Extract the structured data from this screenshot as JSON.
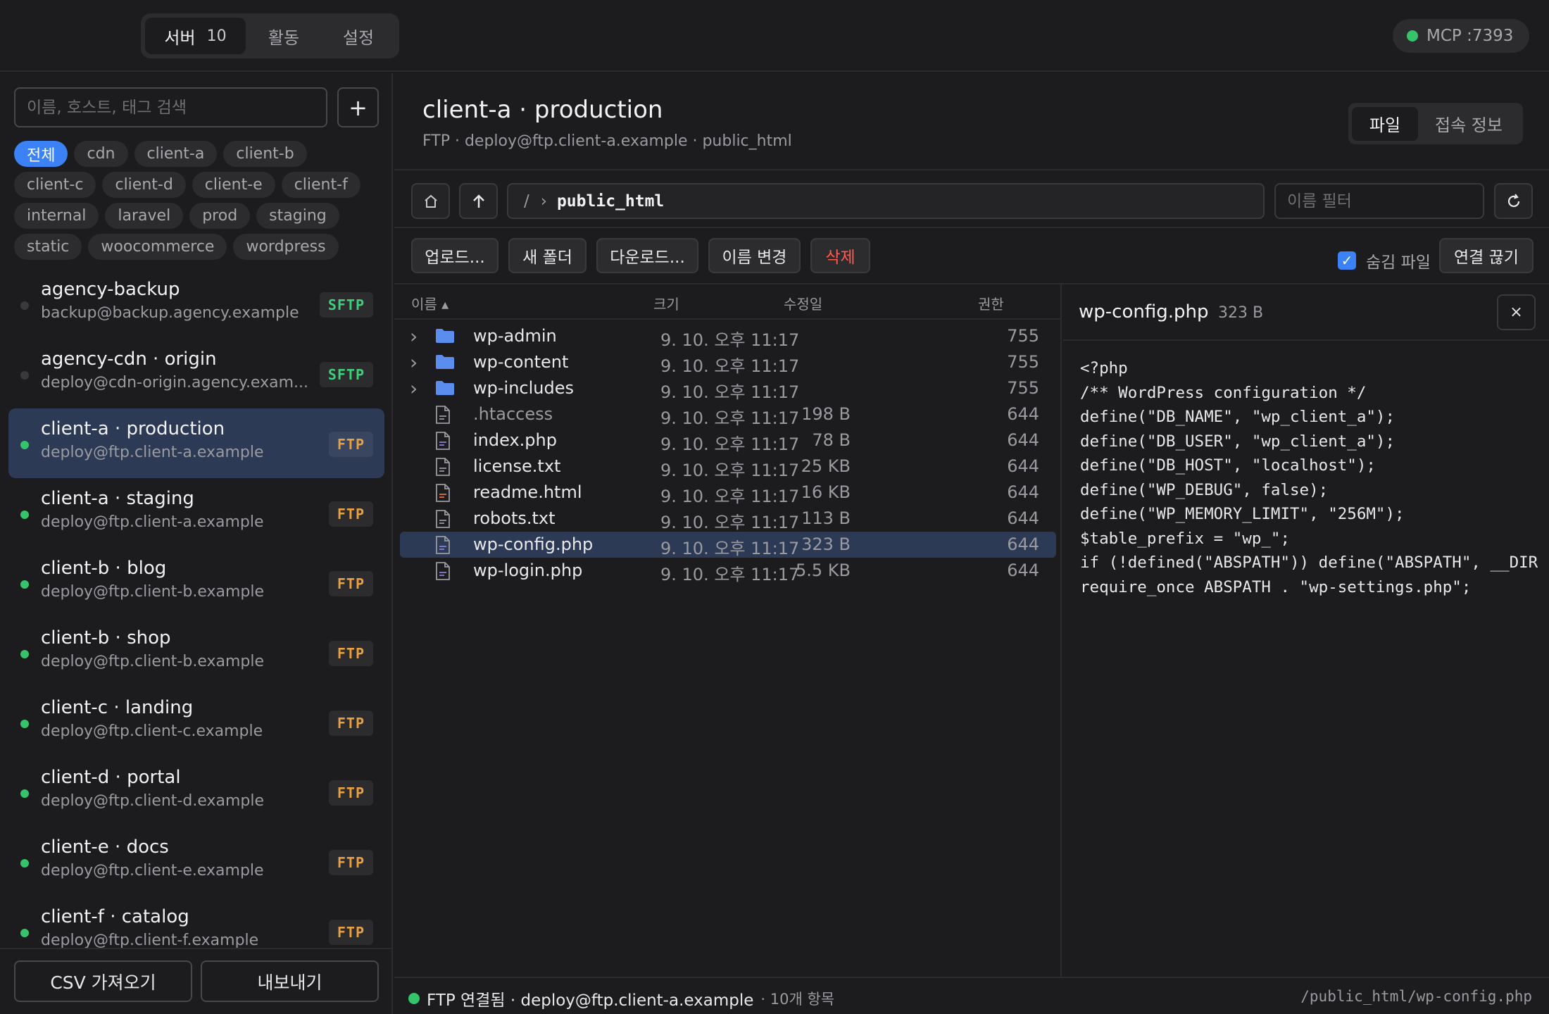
{
  "topbar": {
    "tabs": [
      {
        "label": "서버",
        "count": "10"
      },
      {
        "label": "활동"
      },
      {
        "label": "설정"
      }
    ],
    "mcp_label": "MCP :7393"
  },
  "sidebar": {
    "search_placeholder": "이름, 호스트, 태그 검색",
    "add_label": "+",
    "tags": [
      "전체",
      "cdn",
      "client-a",
      "client-b",
      "client-c",
      "client-d",
      "client-e",
      "client-f",
      "internal",
      "laravel",
      "prod",
      "staging",
      "static",
      "woocommerce",
      "wordpress"
    ],
    "servers": [
      {
        "name": "agency-backup",
        "host": "backup@backup.agency.example",
        "protocol": "SFTP",
        "status": "offline"
      },
      {
        "name": "agency-cdn · origin",
        "host": "deploy@cdn-origin.agency.exam...",
        "protocol": "SFTP",
        "status": "offline"
      },
      {
        "name": "client-a · production",
        "host": "deploy@ftp.client-a.example",
        "protocol": "FTP",
        "status": "online"
      },
      {
        "name": "client-a · staging",
        "host": "deploy@ftp.client-a.example",
        "protocol": "FTP",
        "status": "online"
      },
      {
        "name": "client-b · blog",
        "host": "deploy@ftp.client-b.example",
        "protocol": "FTP",
        "status": "online"
      },
      {
        "name": "client-b · shop",
        "host": "deploy@ftp.client-b.example",
        "protocol": "FTP",
        "status": "online"
      },
      {
        "name": "client-c · landing",
        "host": "deploy@ftp.client-c.example",
        "protocol": "FTP",
        "status": "online"
      },
      {
        "name": "client-d · portal",
        "host": "deploy@ftp.client-d.example",
        "protocol": "FTP",
        "status": "online"
      },
      {
        "name": "client-e · docs",
        "host": "deploy@ftp.client-e.example",
        "protocol": "FTP",
        "status": "online"
      },
      {
        "name": "client-f · catalog",
        "host": "deploy@ftp.client-f.example",
        "protocol": "FTP",
        "status": "online"
      }
    ],
    "import_label": "CSV 가져오기",
    "export_label": "내보내기"
  },
  "main": {
    "title": "client-a · production",
    "subtitle": "FTP · deploy@ftp.client-a.example · public_html",
    "view_tabs": [
      "파일",
      "접속 정보"
    ],
    "path": {
      "root": "/",
      "separator": "›",
      "current": "public_html"
    },
    "filter_placeholder": "이름 필터",
    "actions": {
      "upload": "업로드...",
      "new_folder": "새 폴더",
      "download": "다운로드...",
      "rename": "이름 변경",
      "delete": "삭제",
      "hidden_files": "숨김 파일",
      "disconnect": "연결 끊기"
    },
    "columns": {
      "name": "이름 ▴",
      "size": "크기",
      "modified": "수정일",
      "permissions": "권한"
    },
    "files": [
      {
        "name": "wp-admin",
        "type": "folder",
        "size": "",
        "modified": "9. 10. 오후 11:17",
        "perm": "755"
      },
      {
        "name": "wp-content",
        "type": "folder",
        "size": "",
        "modified": "9. 10. 오후 11:17",
        "perm": "755"
      },
      {
        "name": "wp-includes",
        "type": "folder",
        "size": "",
        "modified": "9. 10. 오후 11:17",
        "perm": "755"
      },
      {
        "name": ".htaccess",
        "type": "file",
        "size": "198 B",
        "modified": "9. 10. 오후 11:17",
        "perm": "644"
      },
      {
        "name": "index.php",
        "type": "file",
        "size": "78 B",
        "modified": "9. 10. 오후 11:17",
        "perm": "644"
      },
      {
        "name": "license.txt",
        "type": "file",
        "size": "25 KB",
        "modified": "9. 10. 오후 11:17",
        "perm": "644"
      },
      {
        "name": "readme.html",
        "type": "file",
        "size": "16 KB",
        "modified": "9. 10. 오후 11:17",
        "perm": "644"
      },
      {
        "name": "robots.txt",
        "type": "file",
        "size": "113 B",
        "modified": "9. 10. 오후 11:17",
        "perm": "644"
      },
      {
        "name": "wp-config.php",
        "type": "file",
        "size": "323 B",
        "modified": "9. 10. 오후 11:17",
        "perm": "644"
      },
      {
        "name": "wp-login.php",
        "type": "file",
        "size": "5.5 KB",
        "modified": "9. 10. 오후 11:17",
        "perm": "644"
      }
    ],
    "preview": {
      "filename": "wp-config.php",
      "size": "323 B",
      "close": "×",
      "lines": [
        "<?php",
        "/** WordPress configuration */",
        "define(\"DB_NAME\", \"wp_client_a\");",
        "define(\"DB_USER\", \"wp_client_a\");",
        "define(\"DB_HOST\", \"localhost\");",
        "define(\"WP_DEBUG\", false);",
        "define(\"WP_MEMORY_LIMIT\", \"256M\");",
        "$table_prefix = \"wp_\";",
        "if (!defined(\"ABSPATH\")) define(\"ABSPATH\", __DIR",
        "require_once ABSPATH . \"wp-settings.php\";"
      ]
    },
    "status": {
      "connection": "FTP 연결됨 · deploy@ftp.client-a.example",
      "count": "· 10개 항목",
      "path": "/public_html/wp-config.php"
    }
  },
  "colors": {
    "accent": "#3b82f6",
    "online": "#35c46a",
    "sftp": "#3ecf7a",
    "ftp": "#e8a040",
    "danger": "#ff5a4f",
    "selection": "#2c3a55"
  }
}
